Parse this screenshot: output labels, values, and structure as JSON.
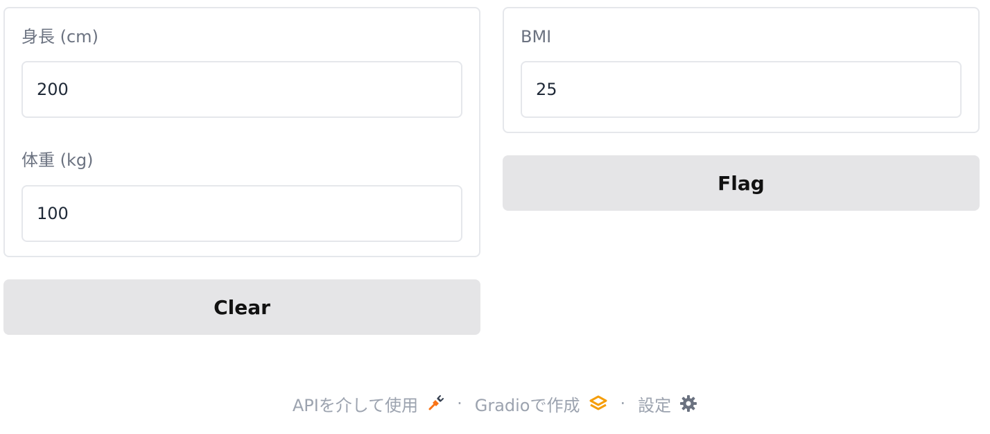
{
  "inputs": {
    "height": {
      "label": "身長 (cm)",
      "value": "200"
    },
    "weight": {
      "label": "体重 (kg)",
      "value": "100"
    }
  },
  "output": {
    "label": "BMI",
    "value": "25"
  },
  "buttons": {
    "clear": "Clear",
    "flag": "Flag"
  },
  "footer": {
    "api": "APIを介して使用",
    "separator": "·",
    "gradio": "Gradioで作成",
    "settings": "設定"
  },
  "icons": {
    "api": "rocket-plug-icon",
    "gradio": "gradio-logo-icon",
    "settings": "gear-icon"
  },
  "colors": {
    "api_icon": "#f97316",
    "gradio_icon": "#f59e0b",
    "settings_icon": "#6b7280"
  }
}
